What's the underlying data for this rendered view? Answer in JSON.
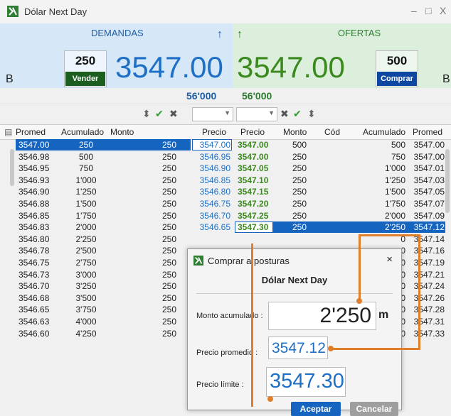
{
  "window": {
    "title": "Dólar Next Day",
    "controls": [
      "–",
      "□",
      "X"
    ]
  },
  "demandas": {
    "title": "DEMANDAS",
    "qty": "250",
    "button": "Vender",
    "price": "3547.00",
    "side": "B",
    "total": "56'000"
  },
  "ofertas": {
    "title": "OFERTAS",
    "qty": "500",
    "button": "Comprar",
    "price": "3547.00",
    "side": "B",
    "total": "56'000"
  },
  "columns": {
    "demand": [
      "Promed",
      "Acumulado",
      "Monto",
      "Precio"
    ],
    "offer": [
      "Precio",
      "Monto",
      "Cód",
      "Acumulado",
      "Promed"
    ]
  },
  "demand_rows": [
    {
      "promed": "3547.00",
      "acum": "250",
      "monto": "250",
      "precio": "3547.00"
    },
    {
      "promed": "3546.98",
      "acum": "500",
      "monto": "250",
      "precio": "3546.95"
    },
    {
      "promed": "3546.95",
      "acum": "750",
      "monto": "250",
      "precio": "3546.90"
    },
    {
      "promed": "3546.93",
      "acum": "1'000",
      "monto": "250",
      "precio": "3546.85"
    },
    {
      "promed": "3546.90",
      "acum": "1'250",
      "monto": "250",
      "precio": "3546.80"
    },
    {
      "promed": "3546.88",
      "acum": "1'500",
      "monto": "250",
      "precio": "3546.75"
    },
    {
      "promed": "3546.85",
      "acum": "1'750",
      "monto": "250",
      "precio": "3546.70"
    },
    {
      "promed": "3546.83",
      "acum": "2'000",
      "monto": "250",
      "precio": "3546.65"
    },
    {
      "promed": "3546.80",
      "acum": "2'250",
      "monto": "250",
      "precio": ""
    },
    {
      "promed": "3546.78",
      "acum": "2'500",
      "monto": "250",
      "precio": ""
    },
    {
      "promed": "3546.75",
      "acum": "2'750",
      "monto": "250",
      "precio": ""
    },
    {
      "promed": "3546.73",
      "acum": "3'000",
      "monto": "250",
      "precio": ""
    },
    {
      "promed": "3546.70",
      "acum": "3'250",
      "monto": "250",
      "precio": ""
    },
    {
      "promed": "3546.68",
      "acum": "3'500",
      "monto": "250",
      "precio": ""
    },
    {
      "promed": "3546.65",
      "acum": "3'750",
      "monto": "250",
      "precio": ""
    },
    {
      "promed": "3546.63",
      "acum": "4'000",
      "monto": "250",
      "precio": ""
    },
    {
      "promed": "3546.60",
      "acum": "4'250",
      "monto": "250",
      "precio": ""
    }
  ],
  "offer_rows": [
    {
      "precio": "3547.00",
      "monto": "500",
      "acum": "500",
      "promed": "3547.00"
    },
    {
      "precio": "3547.00",
      "monto": "250",
      "acum": "750",
      "promed": "3547.00"
    },
    {
      "precio": "3547.05",
      "monto": "250",
      "acum": "1'000",
      "promed": "3547.01"
    },
    {
      "precio": "3547.10",
      "monto": "250",
      "acum": "1'250",
      "promed": "3547.03"
    },
    {
      "precio": "3547.15",
      "monto": "250",
      "acum": "1'500",
      "promed": "3547.05"
    },
    {
      "precio": "3547.20",
      "monto": "250",
      "acum": "1'750",
      "promed": "3547.07"
    },
    {
      "precio": "3547.25",
      "monto": "250",
      "acum": "2'000",
      "promed": "3547.09"
    },
    {
      "precio": "3547.30",
      "monto": "250",
      "acum": "2'250",
      "promed": "3547.12"
    },
    {
      "acum": "0",
      "promed": "3547.14"
    },
    {
      "acum": "0",
      "promed": "3547.16"
    },
    {
      "acum": "0",
      "promed": "3547.19"
    },
    {
      "acum": "0",
      "promed": "3547.21"
    },
    {
      "acum": "0",
      "promed": "3547.24"
    },
    {
      "acum": "0",
      "promed": "3547.26"
    },
    {
      "acum": "0",
      "promed": "3547.28"
    },
    {
      "acum": "0",
      "promed": "3547.31"
    },
    {
      "acum": "0",
      "promed": "3547.33"
    }
  ],
  "dialog": {
    "title": "Comprar a posturas",
    "subtitle": "Dólar Next Day",
    "monto_label": "Monto acumulado :",
    "monto_value": "2'250",
    "monto_unit": "m",
    "promedio_label": "Precio promedio :",
    "promedio_value": "3547.12",
    "limite_label": "Precio límite :",
    "limite_value": "3547.30",
    "accept": "Aceptar",
    "cancel": "Cancelar"
  },
  "colors": {
    "demand_blue": "#1e6fc6",
    "offer_green": "#3b8a1e",
    "selection": "#1565c0",
    "highlight": "#e07f2b"
  },
  "icons": [
    "app-logo-icon",
    "sort-arrows-icon",
    "check-icon",
    "clear-icon",
    "up-arrow-icon",
    "dropdown-icon"
  ]
}
